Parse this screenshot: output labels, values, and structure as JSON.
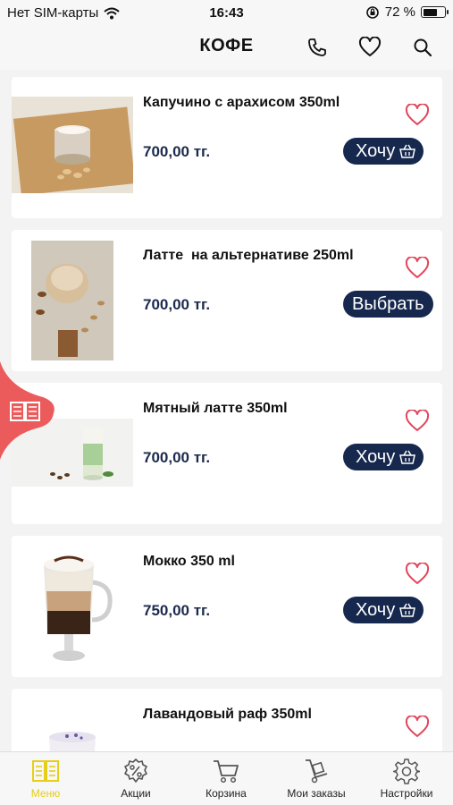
{
  "status": {
    "carrier": "Нет SIM-карты",
    "time": "16:43",
    "battery": "72 %",
    "battery_level": 0.72
  },
  "header": {
    "title": "КОФЕ"
  },
  "products": [
    {
      "name": "Капучино с арахисом 350ml",
      "price": "700,00 тг.",
      "button": "Хочу"
    },
    {
      "name": "Латте  на альтернативе 250ml",
      "price": "700,00 тг.",
      "button": "Выбрать"
    },
    {
      "name": "Мятный латте 350ml",
      "price": "700,00 тг.",
      "button": "Хочу"
    },
    {
      "name": "Мокко 350 ml",
      "price": "750,00 тг.",
      "button": "Хочу"
    },
    {
      "name": "Лавандовый раф 350ml",
      "price": "",
      "button": ""
    }
  ],
  "tabs": [
    {
      "label": "Меню",
      "icon": "menu-book-icon"
    },
    {
      "label": "Акции",
      "icon": "discount-icon"
    },
    {
      "label": "Корзина",
      "icon": "cart-icon"
    },
    {
      "label": "Мои заказы",
      "icon": "hand-truck-icon"
    },
    {
      "label": "Настройки",
      "icon": "gear-icon"
    }
  ],
  "colors": {
    "accent": "#e6cf16",
    "button": "#17284e",
    "price": "#1b2a4e",
    "heart": "#e0455a",
    "side_tab": "#ec5b5b"
  }
}
